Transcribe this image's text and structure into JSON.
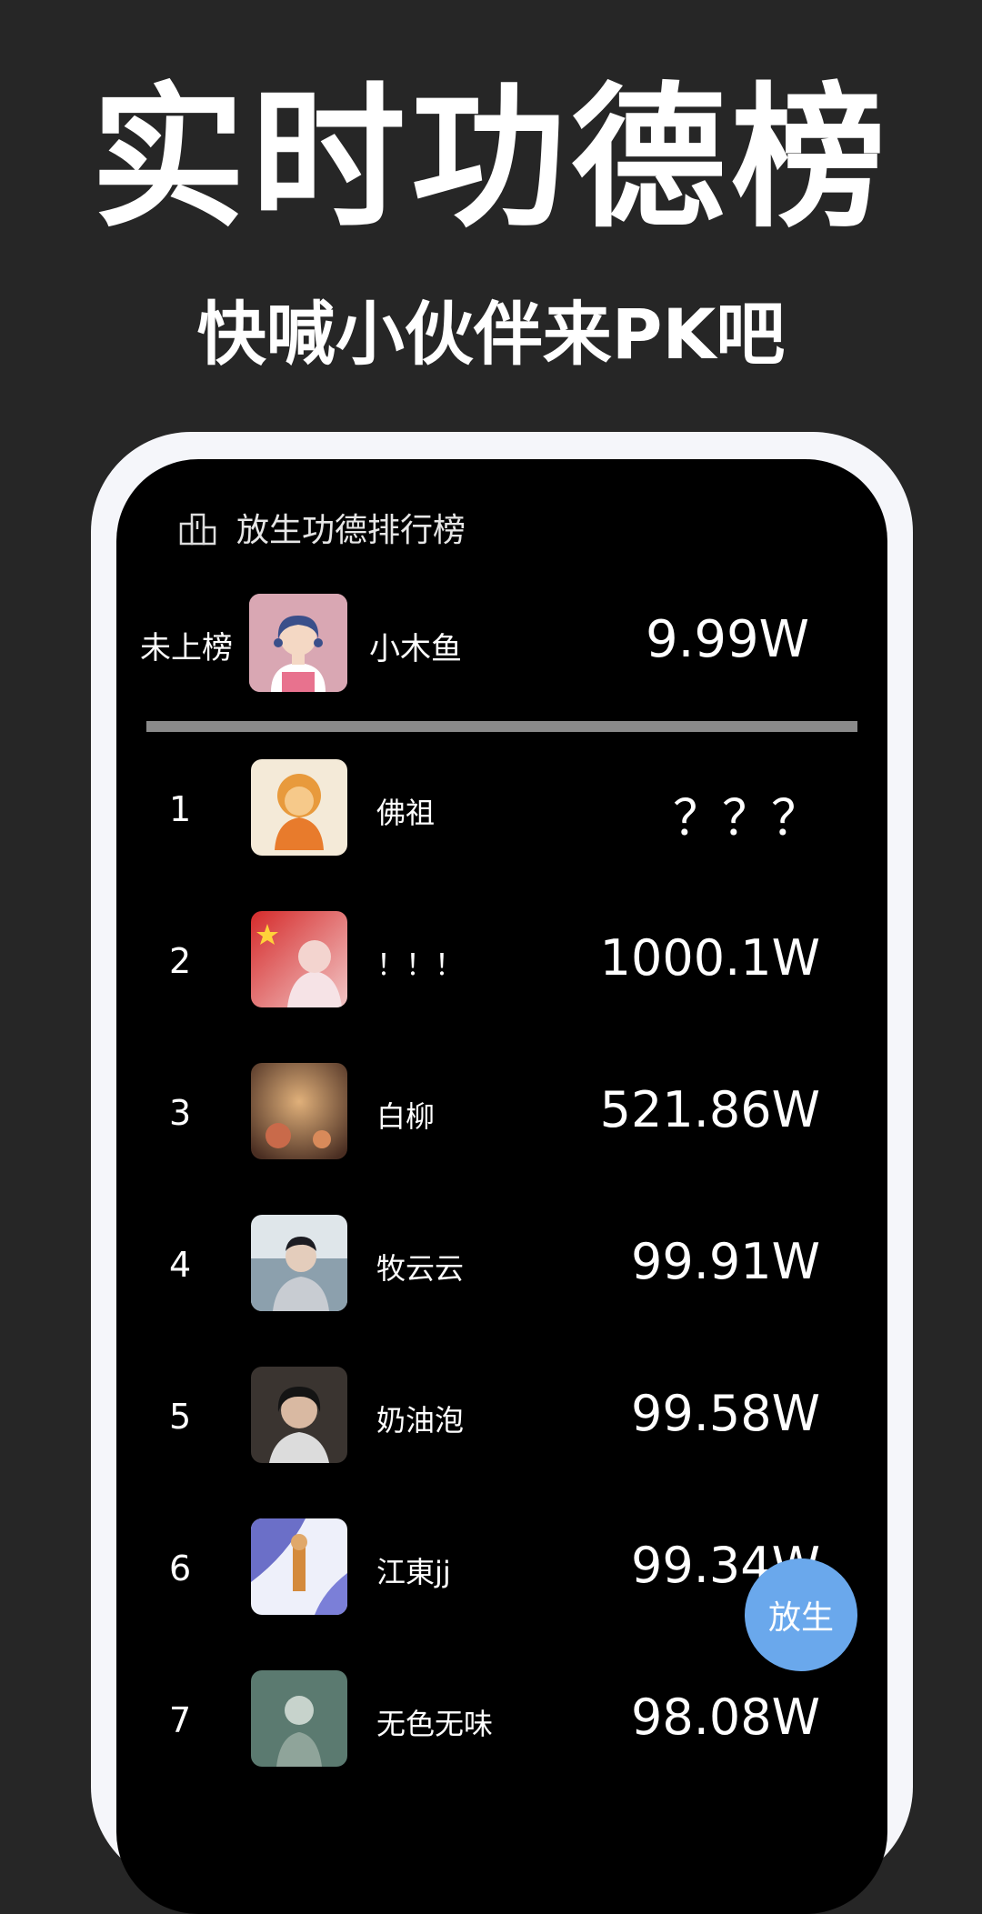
{
  "headline": "实时功德榜",
  "subheadline": "快喊小伙伴来PK吧",
  "board": {
    "title": "放生功德排行榜",
    "icon": "podium-icon"
  },
  "current_user": {
    "rank_label": "未上榜",
    "name": "小木鱼",
    "score": "9.99W",
    "avatar": "girl-avatar"
  },
  "ranking": [
    {
      "rank": "1",
      "name": "佛祖",
      "score": "？？？",
      "avatar_color": "#f4ead8"
    },
    {
      "rank": "2",
      "name": "！！！",
      "score": "1000.1W",
      "avatar_color": "#c23a3a"
    },
    {
      "rank": "3",
      "name": "白柳",
      "score": "521.86W",
      "avatar_color": "#7a5238"
    },
    {
      "rank": "4",
      "name": "牧云云",
      "score": "99.91W",
      "avatar_color": "#b8c4cc"
    },
    {
      "rank": "5",
      "name": "奶油泡",
      "score": "99.58W",
      "avatar_color": "#3a3430"
    },
    {
      "rank": "6",
      "name": "江東jj",
      "score": "99.34W",
      "avatar_color": "#6b6fc8"
    },
    {
      "rank": "7",
      "name": "无色无味",
      "score": "98.08W",
      "avatar_color": "#5b7a70"
    }
  ],
  "release_button": {
    "label": "放生",
    "color": "#6aa8ec"
  }
}
